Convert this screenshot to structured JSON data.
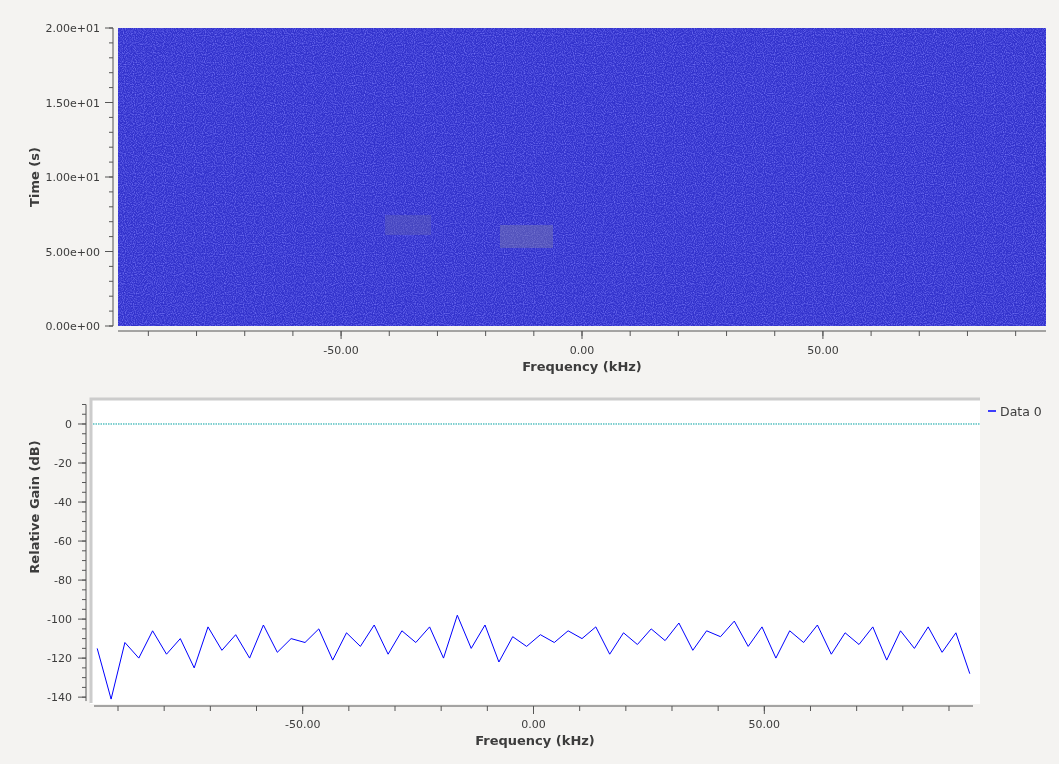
{
  "waterfall": {
    "ylabel": "Time (s)",
    "xlabel": "Frequency (kHz)",
    "yticks": [
      "2.00e+01",
      "1.50e+01",
      "1.00e+01",
      "5.00e+00",
      "0.00e+00"
    ],
    "xticks": [
      "-50.00",
      "0.00",
      "50.00"
    ]
  },
  "spectrum": {
    "chart_data": {
      "type": "line",
      "xlabel": "Frequency (kHz)",
      "ylabel": "Relative Gain (dB)",
      "xlim": [
        -95.2,
        95.2
      ],
      "ylim": [
        -143,
        12.3
      ],
      "xticks": [
        {
          "value": -50,
          "label": "-50.00"
        },
        {
          "value": 0,
          "label": "0.00"
        },
        {
          "value": 50,
          "label": "50.00"
        }
      ],
      "yticks": [
        0,
        -20,
        -40,
        -60,
        -80,
        -100,
        -120,
        -140
      ],
      "x": [
        -94.5,
        -91.5,
        -88.5,
        -85.5,
        -82.5,
        -79.5,
        -76.5,
        -73.5,
        -70.5,
        -67.5,
        -64.5,
        -61.5,
        -58.5,
        -55.5,
        -52.5,
        -49.5,
        -46.5,
        -43.5,
        -40.5,
        -37.5,
        -34.5,
        -31.5,
        -28.5,
        -25.5,
        -22.5,
        -19.5,
        -16.5,
        -13.5,
        -10.5,
        -7.5,
        -4.5,
        -1.5,
        1.5,
        4.5,
        7.5,
        10.5,
        13.5,
        16.5,
        19.5,
        22.5,
        25.5,
        28.5,
        31.5,
        34.5,
        37.5,
        40.5,
        43.5,
        46.5,
        49.5,
        52.5,
        55.5,
        58.5,
        61.5,
        64.5,
        67.5,
        70.5,
        73.5,
        76.5,
        79.5,
        82.5,
        85.5,
        88.5,
        91.5,
        94.5
      ],
      "series": [
        {
          "name": "Data 0",
          "color": "#0000ff",
          "values": [
            -115,
            -141,
            -112,
            -120,
            -106,
            -118,
            -110,
            -125,
            -104,
            -116,
            -108,
            -120,
            -103,
            -117,
            -110,
            -112,
            -105,
            -121,
            -107,
            -114,
            -103,
            -118,
            -106,
            -112,
            -104,
            -120,
            -98,
            -115,
            -103,
            -122,
            -109,
            -114,
            -108,
            -112,
            -106,
            -110,
            -104,
            -118,
            -107,
            -113,
            -105,
            -111,
            -102,
            -116,
            -106,
            -109,
            -101,
            -114,
            -104,
            -120,
            -106,
            -112,
            -103,
            -118,
            -107,
            -113,
            -104,
            -121,
            -106,
            -115,
            -104,
            -117,
            -107,
            -128
          ]
        }
      ],
      "ref_lines": [
        {
          "axis": "y",
          "value": 0
        }
      ]
    }
  }
}
